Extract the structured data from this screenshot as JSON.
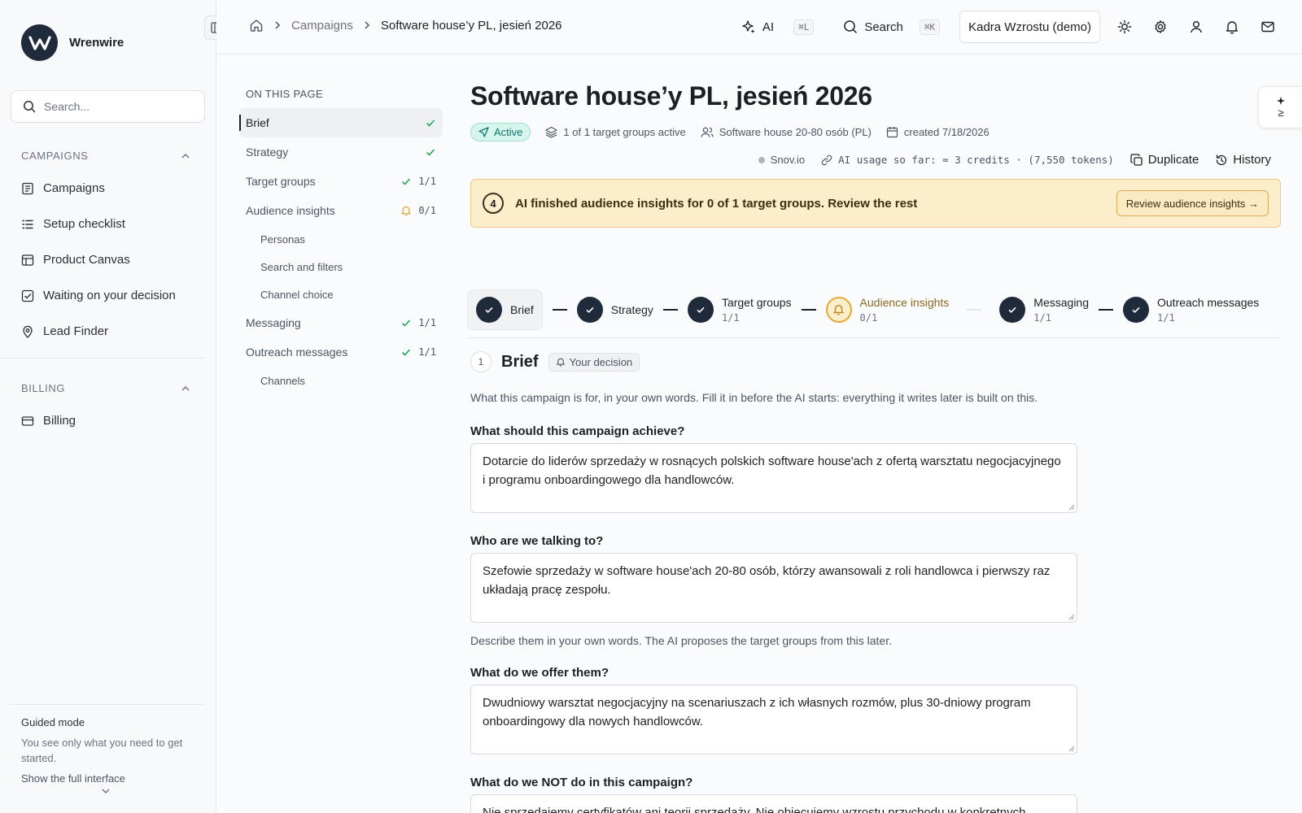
{
  "brand": {
    "name": "Wrenwire"
  },
  "sidebar": {
    "search_placeholder": "Search...",
    "campaigns_section": "CAMPAIGNS",
    "items": [
      {
        "label": "Campaigns",
        "icon": "list-icon"
      },
      {
        "label": "Setup checklist",
        "icon": "checklist-icon"
      },
      {
        "label": "Product Canvas",
        "icon": "canvas-icon"
      },
      {
        "label": "Waiting on your decision",
        "icon": "checkbox-icon"
      },
      {
        "label": "Lead Finder",
        "icon": "map-pin-icon"
      }
    ],
    "billing_section": "BILLING",
    "billing_item": "Billing",
    "guided": {
      "title": "Guided mode",
      "desc": "You see only what you need to get started.",
      "link": "Show the full interface"
    }
  },
  "topbar": {
    "breadcrumb": {
      "root": "Campaigns",
      "current": "Software house’y PL, jesień 2026"
    },
    "ai_label": "AI",
    "ai_kbd": "⌘L",
    "search_label": "Search",
    "search_kbd": "⌘K",
    "workspace": "Kadra Wzrostu (demo)"
  },
  "toc": {
    "heading": "ON THIS PAGE",
    "items": [
      {
        "label": "Brief",
        "status": ""
      },
      {
        "label": "Strategy",
        "status": ""
      },
      {
        "label": "Target groups",
        "status": "1/1"
      },
      {
        "label": "Audience insights",
        "status": "0/1"
      },
      {
        "label": "Personas"
      },
      {
        "label": "Search and filters"
      },
      {
        "label": "Channel choice"
      },
      {
        "label": "Messaging",
        "status": "1/1"
      },
      {
        "label": "Outreach messages",
        "status": "1/1"
      },
      {
        "label": "Channels"
      }
    ]
  },
  "page": {
    "title": "Software house’y PL, jesień 2026",
    "status": "Active",
    "target_groups": "1 of 1 target groups active",
    "audience": "Software house 20-80 osób (PL)",
    "created": "created 7/18/2026",
    "provider": "Snov.io",
    "ai_usage": "AI usage so far: ≈ 3 credits · (7,550 tokens)",
    "duplicate": "Duplicate",
    "history": "History",
    "float_tool": "≥"
  },
  "alert": {
    "number": "4",
    "text": "AI finished audience insights for 0 of 1 target groups. Review the rest",
    "button": "Review audience insights →"
  },
  "stepper": [
    {
      "label": "Brief",
      "count": ""
    },
    {
      "label": "Strategy",
      "count": ""
    },
    {
      "label": "Target groups",
      "count": "1/1"
    },
    {
      "label": "Audience insights",
      "count": "0/1"
    },
    {
      "label": "Messaging",
      "count": "1/1"
    },
    {
      "label": "Outreach messages",
      "count": "1/1"
    }
  ],
  "brief": {
    "number": "1",
    "title": "Brief",
    "decision": "Your decision",
    "desc": "What this campaign is for, in your own words. Fill it in before the AI starts: everything it writes later is built on this.",
    "fields": [
      {
        "label": "What should this campaign achieve?",
        "value": "Dotarcie do liderów sprzedaży w rosnących polskich software house'ach z ofertą warsztatu negocjacyjnego i programu onboardingowego dla handlowców."
      },
      {
        "label": "Who are we talking to?",
        "value": "Szefowie sprzedaży w software house'ach 20-80 osób, którzy awansowali z roli handlowca i pierwszy raz układają pracę zespołu.",
        "help": "Describe them in your own words. The AI proposes the target groups from this later."
      },
      {
        "label": "What do we offer them?",
        "value": "Dwudniowy warsztat negocjacyjny na scenariuszach z ich własnych rozmów, plus 30-dniowy program onboardingowy dla nowych handlowców."
      },
      {
        "label": "What do we NOT do in this campaign?",
        "value": "Nie sprzedajemy certyfikatów ani teorii sprzedaży. Nie obiecujemy wzrostu przychodu w konkretnych"
      }
    ]
  },
  "colors": {
    "accent": "#1f2a3a",
    "success": "#16a34a",
    "warning": "#e2aa3c",
    "active_badge": "#d6f5ec"
  }
}
